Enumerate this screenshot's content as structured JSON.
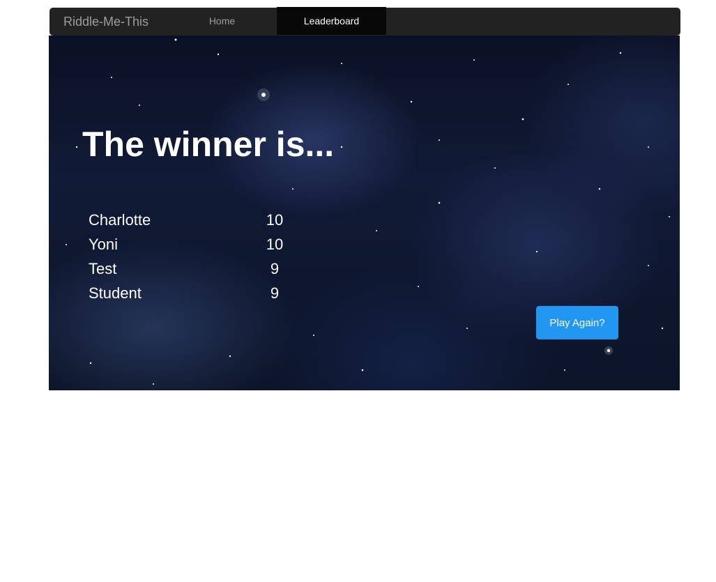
{
  "nav": {
    "brand": "Riddle-Me-This",
    "items": [
      {
        "label": "Home",
        "active": false
      },
      {
        "label": "Leaderboard",
        "active": true
      }
    ]
  },
  "main": {
    "headline": "The winner is...",
    "leaderboard": [
      {
        "name": "Charlotte",
        "score": "10"
      },
      {
        "name": "Yoni",
        "score": "10"
      },
      {
        "name": "Test",
        "score": "9"
      },
      {
        "name": "Student",
        "score": "9"
      }
    ],
    "play_again_label": "Play Again?"
  },
  "colors": {
    "navbar_bg": "#222222",
    "nav_active_bg": "#080808",
    "button_bg": "#2196f3",
    "text": "#ffffff"
  }
}
